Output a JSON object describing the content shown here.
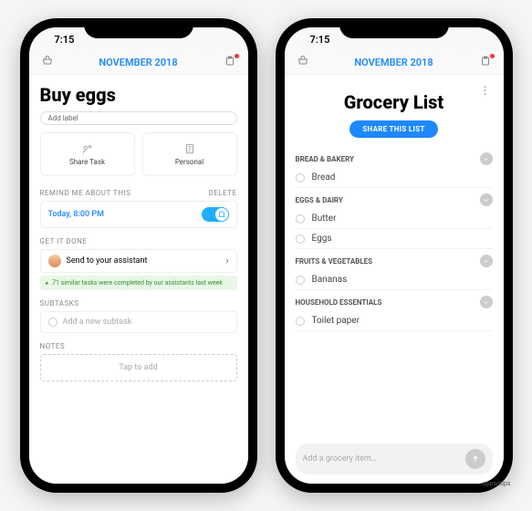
{
  "status": {
    "time": "7:15"
  },
  "nav": {
    "month_label": "NOVEMBER 2018"
  },
  "left": {
    "title": "Buy eggs",
    "add_label_chip": "Add label",
    "tiles": {
      "share": "Share Task",
      "personal": "Personal"
    },
    "remind_header": "REMIND ME ABOUT THIS",
    "delete_label": "DELETE",
    "reminder_time": "Today, 8:00 PM",
    "get_it_done_header": "GET IT DONE",
    "assistant_label": "Send to your assistant",
    "promo": "71 similar tasks were completed by our assistants last week",
    "subtasks_header": "SUBTASKS",
    "add_subtask_placeholder": "Add a new subtask",
    "notes_header": "NOTES",
    "notes_placeholder": "Tap to add"
  },
  "right": {
    "title": "Grocery List",
    "share_button": "SHARE THIS LIST",
    "categories": [
      {
        "name": "BREAD & BAKERY",
        "items": [
          "Bread"
        ]
      },
      {
        "name": "EGGS & DAIRY",
        "items": [
          "Butter",
          "Eggs"
        ]
      },
      {
        "name": "FRUITS & VEGETABLES",
        "items": [
          "Bananas"
        ]
      },
      {
        "name": "HOUSEHOLD ESSENTIALS",
        "items": [
          "Toilet paper"
        ]
      }
    ],
    "add_item_placeholder": "Add a grocery item…"
  },
  "watermark": "appsntips"
}
